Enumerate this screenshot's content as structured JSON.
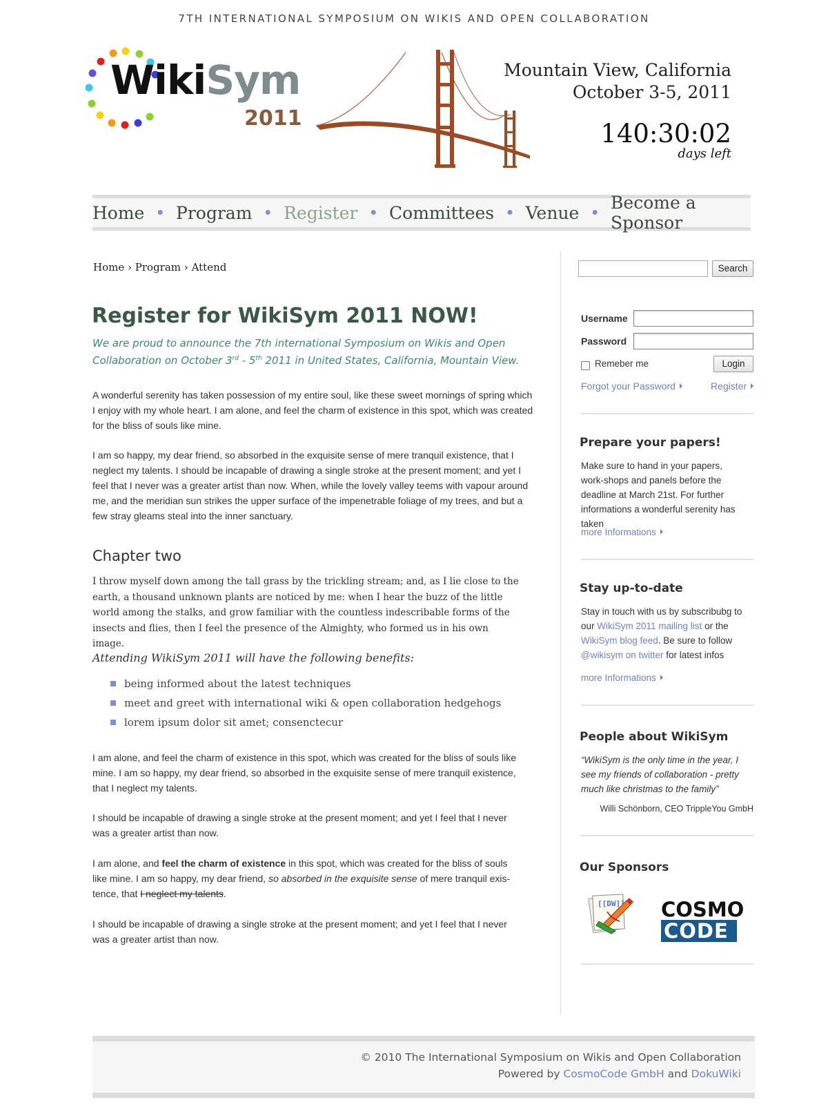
{
  "header": {
    "top_title": "7TH INTERNATIONAL SYMPOSIUM ON WIKIS AND OPEN COLLABORATION",
    "logo": {
      "wiki": "Wiki",
      "sym": "Sym",
      "year": "2011"
    },
    "location": "Mountain View, California",
    "dates": "October 3-5, 2011",
    "countdown": "140:30:02",
    "countdown_label": "days left"
  },
  "nav": {
    "items": [
      {
        "label": "Home",
        "active": false
      },
      {
        "label": "Program",
        "active": false
      },
      {
        "label": "Register",
        "active": true
      },
      {
        "label": "Committees",
        "active": false
      },
      {
        "label": "Venue",
        "active": false
      },
      {
        "label": "Become a Sponsor",
        "active": false
      }
    ]
  },
  "breadcrumb": {
    "home": "Home",
    "sep": "›",
    "program": "Program",
    "attend": "Attend"
  },
  "main": {
    "title": "Register for WikiSym 2011 NOW!",
    "intro_1": "We are proud to announce the 7th international Symposium on Wikis and Open",
    "intro_2a": "Collaboration on October 3",
    "intro_sup1": "rd",
    "intro_2b": " - 5",
    "intro_sup2": "th",
    "intro_2c": " 2011 in United States, California, Mountain View.",
    "p1": "A wonderful serenity has taken possession of my entire soul, like these sweet mornings of spring which I enjoy with my whole heart. I am alone, and feel the charm of existence in this spot, which was created for the bliss of souls like mine.",
    "p2": "I am so happy, my dear friend, so absorbed in the exquisite sense of mere tranquil existence, that I neglect my talents. I should be incapable of drawing a single stroke at the present moment; and yet I feel that I never was a greater artist than now. When, while the lovely valley teems with vapour around me, and the meridian sun strikes the upper surface of the impenetrable foliage of my trees, and but a few stray gleams steal into the inner sanctuary.",
    "h2": "Chapter two",
    "p3": "I throw myself down among the tall grass by the trickling stream; and, as I lie close to the earth, a thousand unknown plants are noticed by me: when I hear the buzz of the little world among the stalks, and grow familiar with the countless indescribable forms of the insects and flies, then I feel the presence of the Almighty, who formed us in his own image.",
    "benefits_title": "Attending WikiSym 2011 will have the following benefits:",
    "benefits": [
      "being informed about the latest techniques",
      "meet and greet with international wiki & open collaboration hedgehogs",
      "lorem ipsum dolor sit amet; consenctecur"
    ],
    "p4": "I am alone, and feel the charm of existence in this spot, which was created for the bliss of souls like mine. I am so happy, my dear friend, so absorbed in the exquisite sense of mere tranquil existence, that I neglect my talents.",
    "p5": "I should be incapable of drawing a single stroke at the present moment; and yet I feel that I never was a greater artist than now.",
    "p6a": "I am alone, and ",
    "p6b": "feel the charm of existence",
    "p6c": " in this spot, which was created for the bliss of souls like mine. I am so happy, my dear friend, ",
    "p6d": "so absorbed in the exquisite sense",
    "p6e": " of mere tranquil exis-tence, that ",
    "p6f": "I neglect my talents",
    "p6g": ".",
    "p7": "I should be incapable of drawing a single stroke at the present moment; and yet I feel that I never was a greater artist than now."
  },
  "sidebar": {
    "search_button": "Search",
    "username_label": "Username",
    "password_label": "Password",
    "remember_label": "Remeber me",
    "login_button": "Login",
    "forgot_link": "Forgot your Password",
    "register_link": "Register",
    "papers": {
      "title": "Prepare your papers!",
      "text": "Make sure to hand in your papers, work-shops and panels before the deadline at March 21st. For further informations a wonderful serenity has taken",
      "more": "more Informations"
    },
    "uptodate": {
      "title": "Stay up-to-date",
      "t1": "Stay in touch with us by subscribubg to our ",
      "l1": "WikiSym 2011 mailing list",
      "t2": " or the ",
      "l2": "WikiSym blog feed",
      "t3": ". Be sure to follow ",
      "l3": "@wikisym on twitter",
      "t4": " for latest infos",
      "more": "more Informations"
    },
    "people": {
      "title": "People about WikiSym",
      "quote": "“WikiSym is the only time in the year, I see my friends of collaboration - pretty much like christmas to the family”",
      "author": "Willi Schönborn, CEO TrippleYou GmbH"
    },
    "sponsors": {
      "title": "Our Sponsors",
      "dokuwiki_text": "[[DW]]",
      "cosmo_top": "COSMO",
      "cosmo_bottom": "CODE"
    }
  },
  "footer": {
    "line1": "© 2010 The International Symposium on Wikis and Open Collaboration",
    "powered": "Powered by ",
    "link1": "CosmoCode GmbH",
    "and": " and ",
    "link2": "DokuWiki"
  }
}
